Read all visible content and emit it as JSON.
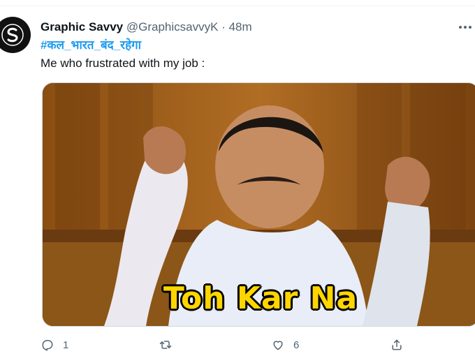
{
  "tweet": {
    "display_name": "Graphic Savvy",
    "handle": "@GraphicsavvyK",
    "separator": "·",
    "time": "48m",
    "hashtag": "#कल_भारत_बंद_रहेगा",
    "text": "Me who frustrated with my job :"
  },
  "media": {
    "caption": "Toh Kar Na",
    "caption_color": "#ffd500"
  },
  "actions": {
    "reply_count": "1",
    "retweet_count": "",
    "like_count": "6",
    "share_count": ""
  },
  "icons": [
    "avatar-logo-icon",
    "more-icon",
    "reply-icon",
    "retweet-icon",
    "like-icon",
    "share-icon"
  ],
  "colors": {
    "link": "#1d9bf0",
    "secondary_text": "#536471",
    "primary_text": "#0f1419"
  }
}
